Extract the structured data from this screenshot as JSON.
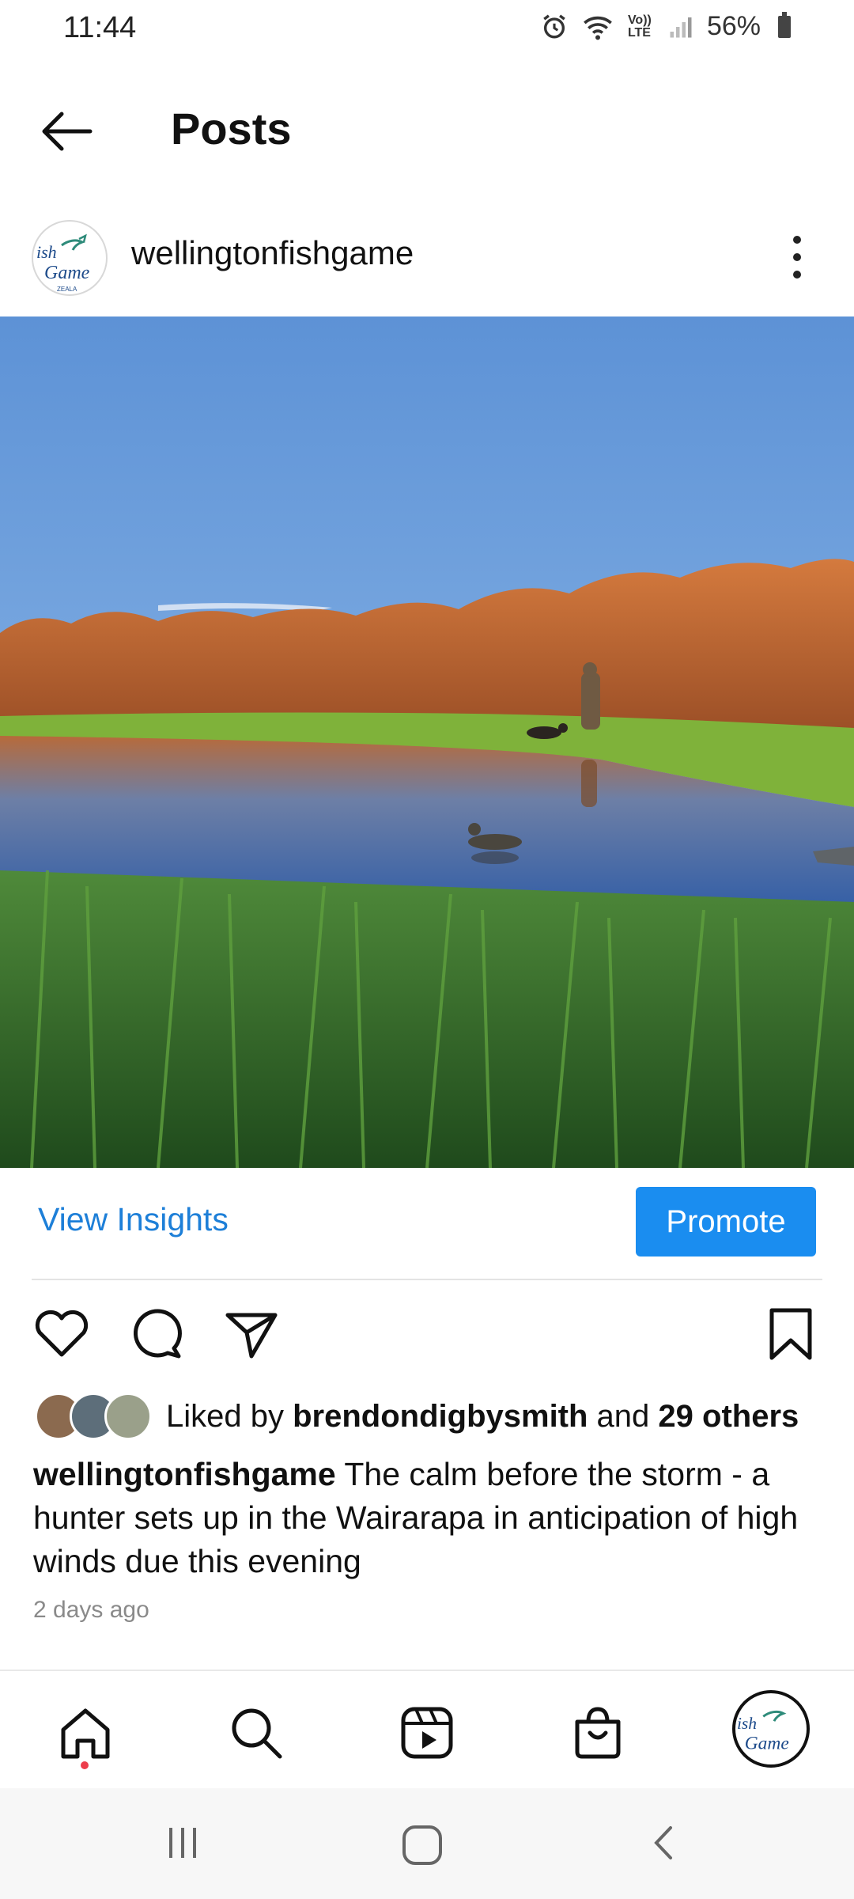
{
  "status_bar": {
    "time": "11:44",
    "lte_label": "Vo)) LTE",
    "battery": "56%"
  },
  "header": {
    "title": "Posts",
    "back_icon": "arrow-left-icon"
  },
  "post": {
    "username": "wellingtonfishgame",
    "avatar_logo_text": "Fish Game",
    "image_description_icon": "landscape-photo",
    "actions": {
      "view_insights": "View Insights",
      "promote": "Promote"
    },
    "likes": {
      "prefix": "Liked by ",
      "liker": "brendondigbysmith",
      "joiner": " and ",
      "others": "29 others"
    },
    "caption": {
      "user": "wellingtonfishgame",
      "text": " The calm before the storm - a hunter sets up in the Wairarapa in anticipation of high winds due this evening"
    },
    "timestamp": "2 days ago"
  },
  "bottom_nav": {
    "items": [
      "home-icon",
      "search-icon",
      "reels-icon",
      "shop-icon",
      "profile-avatar"
    ]
  },
  "system_nav": {
    "items": [
      "recent-apps-icon",
      "home-button-icon",
      "back-chevron-icon"
    ]
  }
}
